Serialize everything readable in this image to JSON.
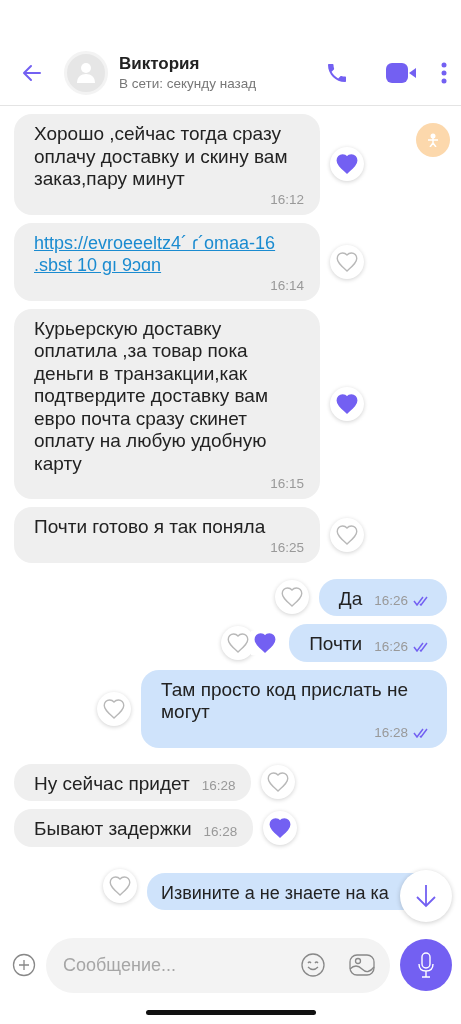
{
  "header": {
    "name": "Виктория",
    "status": "В сети: секунду назад"
  },
  "messages": [
    {
      "kind": "incoming",
      "text": "Хорошо ,сейчас тогда сразу оплачу доставку и скину вам заказ,пару минут",
      "time": "16:12",
      "liked": true
    },
    {
      "kind": "incoming",
      "text": "https://evroeeeltz4´ ɾ´omaa-16 .sbst 10 ɡı 9ɔɑn",
      "time": "16:14",
      "liked": false,
      "link": true
    },
    {
      "kind": "incoming",
      "text": "Курьерскую доставку оплатила ,за товар пока деньги в транзакции,как подтвердите доставку вам евро почта сразу скинет оплату на любую удобную карту",
      "time": "16:15",
      "liked": true
    },
    {
      "kind": "incoming",
      "text": "Почти готово я так поняла",
      "time": "16:25",
      "liked": false
    },
    {
      "kind": "outgoing",
      "text": "Да",
      "time": "16:26",
      "liked": false,
      "peer_liked": false,
      "read": true
    },
    {
      "kind": "outgoing",
      "text": "Почти",
      "time": "16:26",
      "liked": false,
      "peer_liked": true,
      "read": true
    },
    {
      "kind": "outgoing",
      "text": "Там просто код прислать не могут",
      "time": "16:28",
      "liked": false,
      "peer_liked": false,
      "read": true
    },
    {
      "kind": "incoming",
      "text": "Ну сейчас придет",
      "time": "16:28",
      "liked": false
    },
    {
      "kind": "incoming",
      "text": "Бывают задержки",
      "time": "16:28",
      "liked": true
    },
    {
      "kind": "outgoing",
      "text": "Извините а не знаете на ка",
      "liked": false,
      "peer_liked": false
    }
  ],
  "composer": {
    "placeholder": "Сообщение..."
  }
}
